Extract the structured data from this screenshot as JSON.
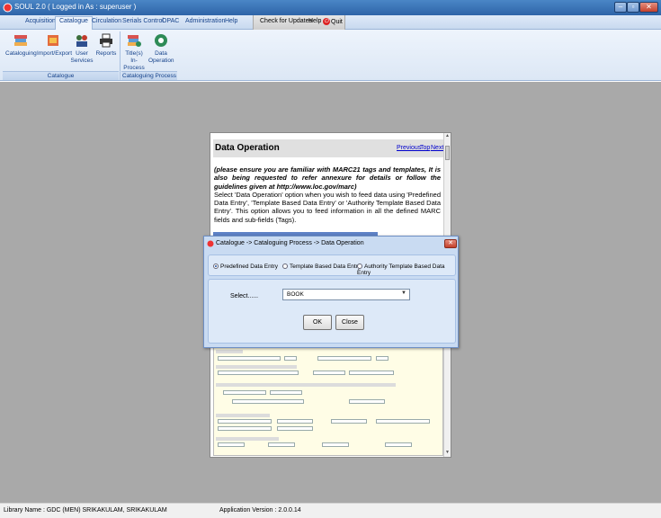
{
  "window": {
    "title": "SOUL 2.0  ( Logged in As : superuser )",
    "min_glyph": "–",
    "max_glyph": "▫",
    "close_glyph": "✕"
  },
  "menu": {
    "tabs": [
      "Acquisition",
      "Catalogue",
      "Circulation",
      "Serials Control",
      "OPAC",
      "Administration",
      "Help"
    ],
    "active_tab": "Catalogue",
    "check_updates": "Check for Updates",
    "help": "Help",
    "quit": "Quit"
  },
  "ribbon": {
    "buttons": [
      {
        "label": "Cataloguing",
        "icon": "books-icon"
      },
      {
        "label": "Import/Export",
        "icon": "import-export-icon"
      },
      {
        "label": "User Services",
        "icon": "users-icon"
      },
      {
        "label": "Reports",
        "icon": "printer-icon"
      },
      {
        "label": "Title(s) In-Process",
        "icon": "title-process-icon"
      },
      {
        "label": "Data Operation",
        "icon": "data-operation-icon"
      }
    ],
    "groups": [
      "Catalogue",
      "Cataloguing Process"
    ]
  },
  "help_doc": {
    "heading": "Data Operation",
    "nav": {
      "previous": "Previous",
      "top": "Top",
      "next": "Next"
    },
    "note": "(please ensure you are familiar with MARC21 tags and templates, It is also being requested to refer annexure for details or follow the guidelines given at http://www.loc.gov/marc)",
    "body": "Select 'Data Operation' option when you wish to feed data using 'Predefined Data Entry', 'Template Based Data Entry' or 'Authority Template Based Data Entry'. This option allows you to feed information in all the defined MARC fields and sub-fields (Tags)."
  },
  "dialog": {
    "title": "Catalogue -> Cataloguing Process -> Data Operation",
    "options": [
      "Predefined Data Entry",
      "Template Based Data Entry",
      "Authority Template Based Data Entry"
    ],
    "selected_option": "Predefined Data Entry",
    "select_label": "Select......",
    "select_value": "BOOK",
    "ok_label": "OK",
    "close_label": "Close"
  },
  "status": {
    "library": "Library Name : GDC (MEN) SRIKAKULAM, SRIKAKULAM",
    "version": "Application Version : 2.0.0.14"
  },
  "colors": {
    "title_bar": "#2e64a8",
    "workspace": "#a9a9a9",
    "dialog_bg": "#c9dbf2",
    "link": "#0000cc"
  }
}
